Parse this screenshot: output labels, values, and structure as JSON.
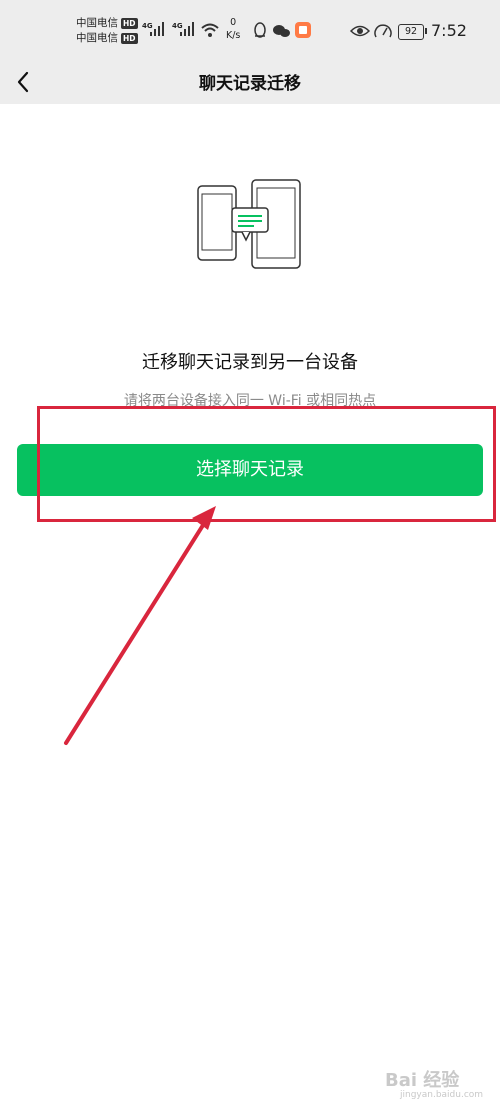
{
  "status_bar": {
    "carrier_1": "中国电信",
    "carrier_2": "中国电信",
    "hd_label": "HD",
    "network_1": "4G",
    "network_2": "4G",
    "speed_value": "0",
    "speed_unit": "K/s",
    "battery": "92",
    "time": "7:52"
  },
  "nav": {
    "title": "聊天记录迁移"
  },
  "main": {
    "headline": "迁移聊天记录到另一台设备",
    "subtitle": "请将两台设备接入同一 Wi-Fi 或相同热点",
    "select_button_label": "选择聊天记录"
  },
  "watermark": {
    "text": "Bai 经验",
    "sub": "jingyan.baidu.com"
  },
  "colors": {
    "accent_green": "#07c160",
    "annotation_red": "#d9263d",
    "nav_background": "#ededed"
  }
}
